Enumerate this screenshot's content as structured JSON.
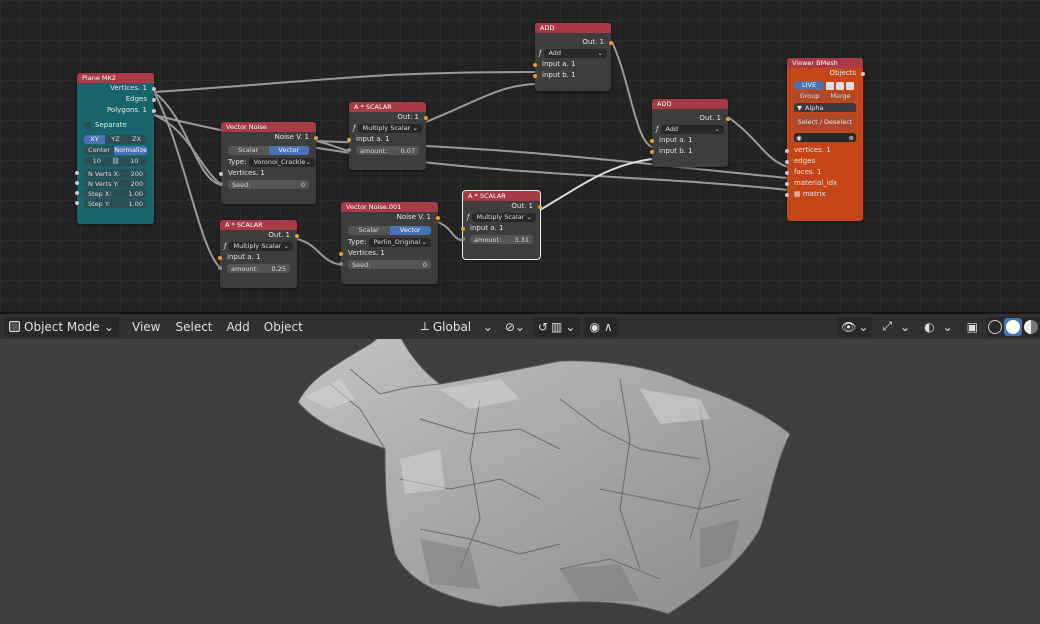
{
  "node_editor": {
    "plane": {
      "title": "Plane MK2",
      "outputs": [
        "Vertices. 1",
        "Edges",
        "Polygons. 1"
      ],
      "separate_label": "Separate",
      "direction_options": [
        "XY",
        "YZ",
        "ZX"
      ],
      "center_label": "Center",
      "normalize_label": "Normalize",
      "res_x": "10",
      "res_y": "10",
      "inputs": [
        {
          "label": "N Verts X:",
          "value": "200"
        },
        {
          "label": "N Verts Y:",
          "value": "200"
        },
        {
          "label": "Step X:",
          "value": "1.00"
        },
        {
          "label": "Step Y:",
          "value": "1.00"
        }
      ]
    },
    "vector_noise_1": {
      "title": "Vector Noise",
      "output": "Noise V. 1",
      "modes": [
        "Scalar",
        "Vector"
      ],
      "type_label": "Type:",
      "type_value": "Voronoi_Crackle",
      "vertices": "Vertices. 1",
      "seed_label": "Seed:",
      "seed_value": "0"
    },
    "vector_noise_2": {
      "title": "Vector Noise.001",
      "output": "Noise V. 1",
      "modes": [
        "Scalar",
        "Vector"
      ],
      "type_label": "Type:",
      "type_value": "Perlin_Original",
      "vertices": "Vertices. 1",
      "seed_label": "Seed:",
      "seed_value": "0"
    },
    "scalar_1": {
      "title": "A * SCALAR",
      "output": "Out. 1",
      "op": "Multiply Scalar",
      "input_a": "input a. 1",
      "amount_label": "amount:",
      "amount_value": "0.07"
    },
    "scalar_2": {
      "title": "A * SCALAR",
      "output": "Out. 1",
      "op": "Multiply Scalar",
      "input_a": "input a. 1",
      "amount_label": "amount:",
      "amount_value": "0.25"
    },
    "scalar_3": {
      "title": "A * SCALAR",
      "output": "Out. 1",
      "op": "Multiply Scalar",
      "input_a": "input a. 1",
      "amount_label": "amount:",
      "amount_value": "3.31"
    },
    "add_1": {
      "title": "ADD",
      "output": "Out. 1",
      "op": "Add",
      "input_a": "input a. 1",
      "input_b": "input b. 1"
    },
    "add_2": {
      "title": "ADD",
      "output": "Out. 1",
      "op": "Add",
      "input_a": "input a. 1",
      "input_b": "input b. 1"
    },
    "viewer": {
      "title": "Viewer BMesh",
      "output": "Objects",
      "live_label": "LIVE",
      "group_label": "Group",
      "merge_label": "Merge",
      "alpha_label": "Alpha",
      "select_label": "Select / Deselect",
      "inputs": [
        "vertices. 1",
        "edges",
        "faces. 1",
        "material_idx",
        "matrix"
      ]
    }
  },
  "viewport_header": {
    "mode_label": "Object Mode",
    "menus": [
      "View",
      "Select",
      "Add",
      "Object"
    ],
    "orientation_label": "Global"
  },
  "colors": {
    "node_header_red": "#a83a46",
    "plane_node": "#16656a",
    "viewer_node": "#c64518",
    "accent_blue": "#4772b3",
    "mesh_gray": "#a8a8a8"
  }
}
